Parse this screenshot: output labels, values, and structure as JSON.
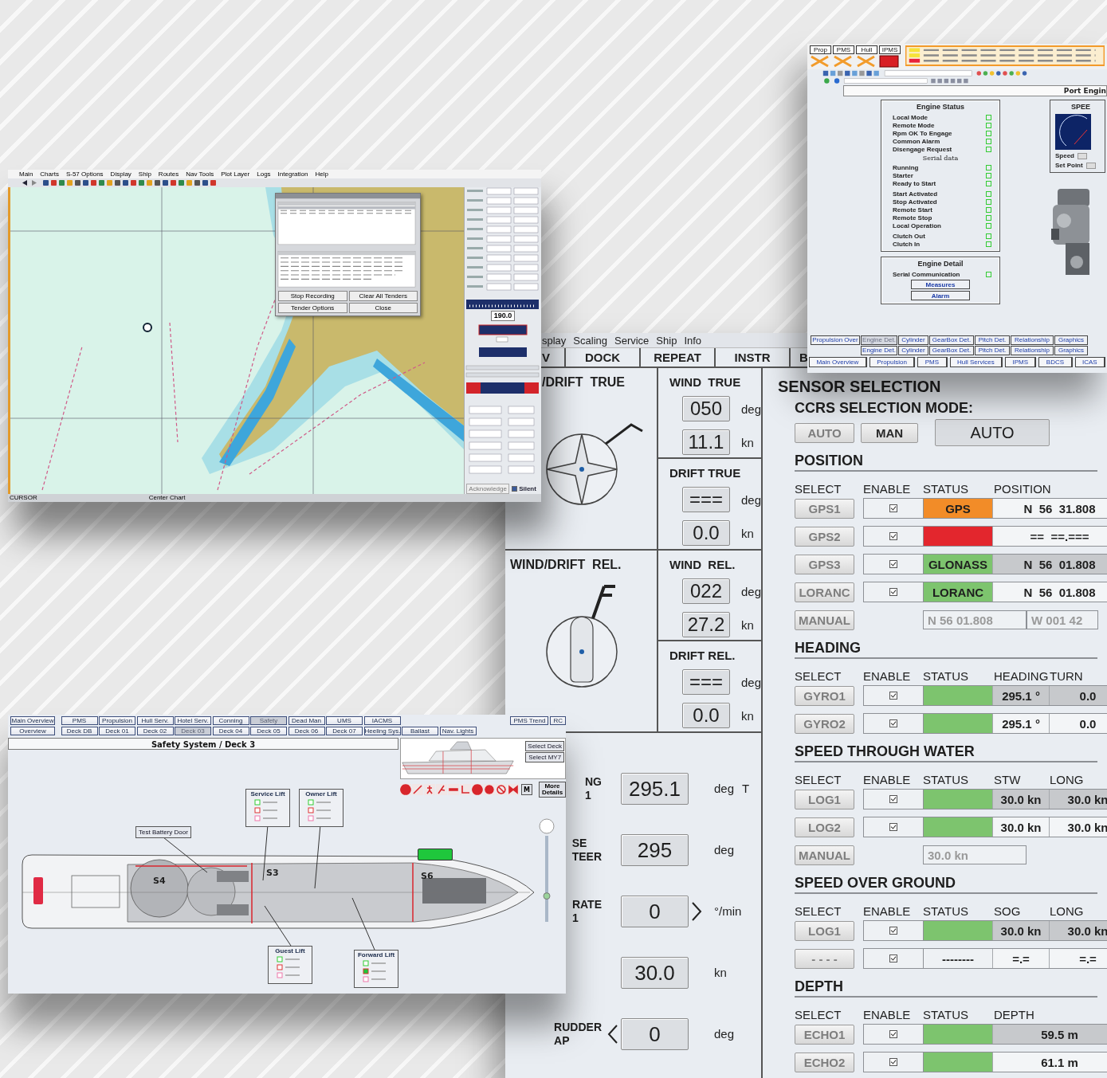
{
  "chart_window": {
    "menu": [
      "Main",
      "Charts",
      "S-57 Options",
      "Display",
      "Ship",
      "Routes",
      "Nav Tools",
      "Plot Layer",
      "Logs",
      "Integration",
      "Help"
    ],
    "dialog": {
      "buttons": [
        "Stop Recording",
        "Clear All Tenders",
        "Tender Options",
        "Close"
      ]
    },
    "sidebar": {
      "heading": "190.0",
      "acknowledge": {
        "label": "Acknowledge",
        "disabled": true
      },
      "silent": {
        "label": "Silent",
        "checked": true
      }
    },
    "status_bar": [
      "CURSOR",
      "Center Chart"
    ]
  },
  "engine_window": {
    "alarm_tabs": [
      {
        "label": "Prop",
        "alarm": false
      },
      {
        "label": "PMS",
        "alarm": false
      },
      {
        "label": "Hull",
        "alarm": false
      },
      {
        "label": "IPMS",
        "alarm": true
      }
    ],
    "title": "Port Engin",
    "status_panel": {
      "title": "Engine Status",
      "groups": [
        {
          "items": [
            "Local Mode",
            "Remote Mode",
            "Rpm OK To Engage",
            "Common Alarm",
            "Disengage Request"
          ]
        },
        {
          "heading": "Serial data",
          "items": [
            "Running",
            "Starter",
            "Ready to Start"
          ]
        },
        {
          "items": [
            "Start Activated",
            "Stop Activated",
            "Remote Start",
            "Remote Stop",
            "Local Operation"
          ]
        },
        {
          "items": [
            "Clutch Out",
            "Clutch In"
          ]
        }
      ]
    },
    "detail_panel": {
      "title": "Engine Detail",
      "items": [
        "Serial Communication"
      ],
      "buttons": [
        "Measures",
        "Alarm"
      ]
    },
    "speed_panel": {
      "title": "SPEE",
      "rows": [
        "Speed",
        "Set Point"
      ]
    },
    "sub_tabs": [
      {
        "label": "Propulsion Over",
        "selected": false
      },
      {
        "label": "Engine Det.",
        "selected": true
      },
      {
        "label": "Cylinder",
        "selected": false
      },
      {
        "label": "GearBox Det.",
        "selected": false
      },
      {
        "label": "Pitch Det.",
        "selected": false
      },
      {
        "label": "Relationship",
        "selected": false
      },
      {
        "label": "Graphics",
        "selected": false
      }
    ],
    "sub_tabs_2": [
      "Engine Det.",
      "Cylinder",
      "GearBox Det.",
      "Pitch Det.",
      "Relationship",
      "Graphics"
    ],
    "main_tabs": [
      "Main Overview",
      "Propulsion",
      "PMS",
      "Hull Services",
      "IPMS",
      "BDCS",
      "ICAS"
    ]
  },
  "ops_window": {
    "menu": [
      "splay",
      "Scaling",
      "Service",
      "Ship",
      "Info"
    ],
    "tabs": [
      {
        "label": "V",
        "selected": false
      },
      {
        "label": "DOCK",
        "selected": false
      },
      {
        "label": "REPEAT",
        "selected": false
      },
      {
        "label": "INSTR",
        "selected": false
      },
      {
        "label": "B",
        "selected": false
      }
    ],
    "quadrants": [
      {
        "kind": "true",
        "title": "/DRIFT  TRUE",
        "blocks": [
          {
            "title": "WIND  TRUE",
            "readings": [
              {
                "value": "050",
                "unit": "deg"
              },
              {
                "value": "11.1",
                "unit": "kn"
              }
            ]
          },
          {
            "title": "DRIFT TRUE",
            "readings": [
              {
                "value": "===",
                "unit": "deg"
              },
              {
                "value": "0.0",
                "unit": "kn"
              }
            ]
          }
        ]
      },
      {
        "kind": "relative",
        "title": "WIND/DRIFT  REL.",
        "blocks": [
          {
            "title": "WIND  REL.",
            "readings": [
              {
                "value": "022",
                "unit": "deg"
              },
              {
                "value": "27.2",
                "unit": "kn"
              }
            ]
          },
          {
            "title": "DRIFT REL.",
            "readings": [
              {
                "value": "===",
                "unit": "deg"
              },
              {
                "value": "0.0",
                "unit": "kn"
              }
            ]
          }
        ]
      }
    ],
    "readouts": [
      {
        "label": [
          "NG",
          "1"
        ],
        "value": "295.1",
        "unit": "deg",
        "suffix": "T"
      },
      {
        "label": [
          "SE",
          "TEER"
        ],
        "value": "295",
        "unit": "deg"
      },
      {
        "label": [
          "RATE",
          "1"
        ],
        "value": "0",
        "arrow_after": true,
        "unit": "°/min"
      },
      {
        "value": "30.0",
        "unit": "kn"
      },
      {
        "label": [
          "RUDDER",
          "AP"
        ],
        "value": "0",
        "arrow_before": true,
        "unit": "deg"
      }
    ],
    "sensor": {
      "title": "SENSOR SELECTION",
      "mode": {
        "label": "CCRS SELECTION MODE:",
        "buttons": [
          {
            "label": "AUTO",
            "disabled": true
          },
          {
            "label": "MAN",
            "disabled": false
          }
        ],
        "display": "AUTO"
      },
      "sections": [
        {
          "title": "POSITION",
          "columns": [
            "SELECT",
            "ENABLE",
            "STATUS",
            "POSITION"
          ],
          "rows": [
            {
              "kind": "sensor",
              "button": "GPS1",
              "enabled": true,
              "status": "GPS",
              "color": "#f28c28",
              "values": [
                {
                  "text": "N  56  31.808",
                  "highlighted": false
                }
              ]
            },
            {
              "kind": "sensor",
              "button": "GPS2",
              "enabled": true,
              "color": "#e3262d",
              "values": [
                {
                  "text": "==  ==.===",
                  "highlighted": false
                }
              ]
            },
            {
              "kind": "sensor",
              "button": "GPS3",
              "enabled": true,
              "status": "GLONASS",
              "color": "#7dc46e",
              "values": [
                {
                  "text": "N  56  01.808",
                  "highlighted": true
                }
              ]
            },
            {
              "kind": "sensor",
              "button": "LORANC",
              "enabled": true,
              "status": "LORANC",
              "color": "#7dc46e",
              "values": [
                {
                  "text": "N  56  01.808",
                  "highlighted": false
                }
              ]
            },
            {
              "kind": "manual",
              "button": "MANUAL",
              "fields": [
                "N 56 01.808",
                "W 001 42"
              ]
            }
          ]
        },
        {
          "title": "HEADING",
          "columns": [
            "SELECT",
            "ENABLE",
            "STATUS",
            "HEADING",
            "TURN"
          ],
          "rows": [
            {
              "kind": "sensor",
              "button": "GYRO1",
              "enabled": true,
              "color": "#7dc46e",
              "values": [
                {
                  "text": "295.1 °",
                  "highlighted": true
                },
                {
                  "text": "0.0",
                  "highlighted": true
                }
              ]
            },
            {
              "kind": "sensor",
              "button": "GYRO2",
              "enabled": true,
              "color": "#7dc46e",
              "values": [
                {
                  "text": "295.1 °",
                  "highlighted": false
                },
                {
                  "text": "0.0",
                  "highlighted": false
                }
              ]
            }
          ]
        },
        {
          "title": "SPEED THROUGH WATER",
          "columns": [
            "SELECT",
            "ENABLE",
            "STATUS",
            "STW",
            "LONG"
          ],
          "rows": [
            {
              "kind": "sensor",
              "button": "LOG1",
              "enabled": true,
              "color": "#7dc46e",
              "values": [
                {
                  "text": "30.0 kn",
                  "highlighted": true
                },
                {
                  "text": "30.0 kn",
                  "highlighted": true
                }
              ]
            },
            {
              "kind": "sensor",
              "button": "LOG2",
              "enabled": true,
              "color": "#7dc46e",
              "values": [
                {
                  "text": "30.0 kn",
                  "highlighted": false
                },
                {
                  "text": "30.0 kn",
                  "highlighted": false
                }
              ]
            },
            {
              "kind": "manual",
              "button": "MANUAL",
              "fields": [
                "30.0 kn"
              ]
            }
          ]
        },
        {
          "title": "SPEED OVER GROUND",
          "columns": [
            "SELECT",
            "ENABLE",
            "STATUS",
            "SOG",
            "LONG"
          ],
          "rows": [
            {
              "kind": "sensor",
              "button": "LOG1",
              "enabled": true,
              "color": "#7dc46e",
              "values": [
                {
                  "text": "30.0 kn",
                  "highlighted": true
                },
                {
                  "text": "30.0 kn",
                  "highlighted": true
                }
              ]
            },
            {
              "kind": "sensor",
              "button": "- - - -",
              "enabled": true,
              "status": "--------",
              "values": [
                {
                  "text": "=.=",
                  "highlighted": false
                },
                {
                  "text": "=.=",
                  "highlighted": false
                }
              ]
            }
          ]
        },
        {
          "title": "DEPTH",
          "columns": [
            "SELECT",
            "ENABLE",
            "STATUS",
            "DEPTH"
          ],
          "rows": [
            {
              "kind": "sensor",
              "button": "ECHO1",
              "enabled": true,
              "color": "#7dc46e",
              "values": [
                {
                  "text": "59.5 m",
                  "highlighted": true
                }
              ]
            },
            {
              "kind": "sensor",
              "button": "ECHO2",
              "enabled": true,
              "color": "#7dc46e",
              "values": [
                {
                  "text": "61.1 m",
                  "highlighted": false
                }
              ]
            }
          ]
        }
      ]
    }
  },
  "safety_window": {
    "tabs": [
      [
        {
          "label": "Main Overview",
          "selected": false
        },
        {
          "label": "PMS",
          "selected": false
        },
        {
          "label": "Propulsion",
          "selected": false
        },
        {
          "label": "Hull Serv.",
          "selected": false
        },
        {
          "label": "Hotel Serv.",
          "selected": false
        },
        {
          "label": "Conning",
          "selected": false
        },
        {
          "label": "Safety",
          "selected": true
        },
        {
          "label": "Dead Man",
          "selected": false
        },
        {
          "label": "UMS",
          "selected": false
        },
        {
          "label": "IACMS",
          "selected": false
        }
      ],
      [
        {
          "label": "Overview",
          "selected": false
        },
        {
          "label": "Deck DB",
          "selected": false
        },
        {
          "label": "Deck 01",
          "selected": false
        },
        {
          "label": "Deck 02",
          "selected": false
        },
        {
          "label": "Deck 03",
          "selected": true
        },
        {
          "label": "Deck 04",
          "selected": false
        },
        {
          "label": "Deck 05",
          "selected": false
        },
        {
          "label": "Deck 06",
          "selected": false
        },
        {
          "label": "Deck 07",
          "selected": false
        },
        {
          "label": "Heeling Sys.",
          "selected": false
        },
        {
          "label": "Ballast",
          "selected": false
        },
        {
          "label": "Nav. Lights",
          "selected": false
        }
      ]
    ],
    "side_tabs": [
      "PMS Trend",
      "RC"
    ],
    "title": "Safety System / Deck 3",
    "deck_buttons": [
      "Select Deck",
      "Select MY7"
    ],
    "m_button": "M",
    "more_button": "More Details",
    "zones": [
      "S4",
      "S3",
      "S6"
    ],
    "zoom": {
      "level": 0.3
    },
    "callouts": [
      {
        "kind": "lift",
        "label": "Service Lift",
        "indicators": [
          false,
          false,
          false
        ]
      },
      {
        "kind": "lift",
        "label": "Owner Lift",
        "indicators": [
          false,
          false,
          false
        ]
      },
      {
        "kind": "button",
        "label": "Test Battery Door"
      },
      {
        "kind": "lift",
        "label": "Guest Lift",
        "indicators": [
          false,
          false,
          false
        ]
      },
      {
        "kind": "lift",
        "label": "Forward Lift",
        "indicators": [
          false,
          true,
          false
        ]
      }
    ]
  }
}
